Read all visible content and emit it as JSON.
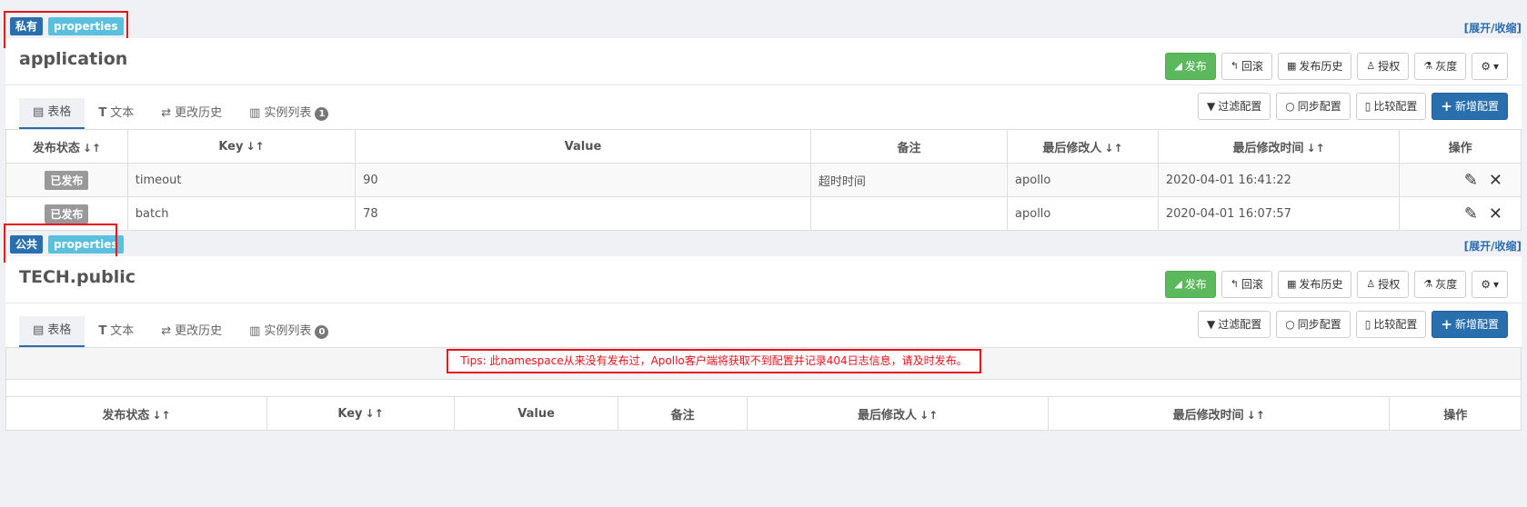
{
  "toggle_label": "[展开/收缩]",
  "namespaces": [
    {
      "scope": "私有",
      "format": "properties",
      "name": "application",
      "actions": {
        "publish": "发布",
        "rollback": "回滚",
        "history": "发布历史",
        "auth": "授权",
        "gray": "灰度"
      },
      "tabs": {
        "table": "表格",
        "text": "文本",
        "change_history": "更改历史",
        "instances": "实例列表",
        "instance_count": "1"
      },
      "tab_actions": {
        "filter": "过滤配置",
        "sync": "同步配置",
        "compare": "比较配置",
        "add": "新增配置"
      },
      "columns": [
        "发布状态",
        "Key",
        "Value",
        "备注",
        "最后修改人",
        "最后修改时间",
        "操作"
      ],
      "rows": [
        {
          "status": "已发布",
          "key": "timeout",
          "value": "90",
          "comment": "超时时间",
          "modifier": "apollo",
          "time": "2020-04-01 16:41:22"
        },
        {
          "status": "已发布",
          "key": "batch",
          "value": "78",
          "comment": "",
          "modifier": "apollo",
          "time": "2020-04-01 16:07:57"
        }
      ]
    },
    {
      "scope": "公共",
      "format": "properties",
      "name": "TECH.public",
      "actions": {
        "publish": "发布",
        "rollback": "回滚",
        "history": "发布历史",
        "auth": "授权",
        "gray": "灰度"
      },
      "tabs": {
        "table": "表格",
        "text": "文本",
        "change_history": "更改历史",
        "instances": "实例列表",
        "instance_count": "0"
      },
      "tab_actions": {
        "filter": "过滤配置",
        "sync": "同步配置",
        "compare": "比较配置",
        "add": "新增配置"
      },
      "tips": "Tips: 此namespace从来没有发布过，Apollo客户端将获取不到配置并记录404日志信息，请及时发布。",
      "columns": [
        "发布状态",
        "Key",
        "Value",
        "备注",
        "最后修改人",
        "最后修改时间",
        "操作"
      ]
    }
  ],
  "colors": {
    "primary": "#2a6fad",
    "success": "#5cb85c",
    "info": "#5bc0de",
    "highlight": "#e8101b"
  }
}
